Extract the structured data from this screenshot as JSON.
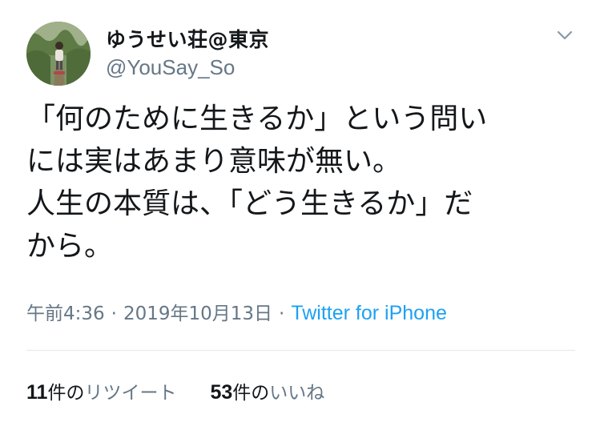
{
  "user": {
    "display_name": "ゆうせい荘@東京",
    "handle": "@YouSay_So",
    "avatar_icon": "profile-photo"
  },
  "tweet": {
    "lines": [
      "「何のために生きるか」という問い",
      "には実はあまり意味が無い。",
      "人生の本質は、「どう生きるか」だ",
      "から。"
    ],
    "time": "午前4:36",
    "separator": "·",
    "date": "2019年10月13日",
    "source": "Twitter for iPhone"
  },
  "stats": {
    "retweets": {
      "count": "11",
      "unit": "件の",
      "label": "リツイート"
    },
    "likes": {
      "count": "53",
      "unit": "件の",
      "label": "いいね"
    }
  },
  "menu_icon": "chevron-down",
  "colors": {
    "text": "#14171a",
    "secondary": "#657786",
    "link": "#1da1f2",
    "divider": "#e1e8ed"
  }
}
